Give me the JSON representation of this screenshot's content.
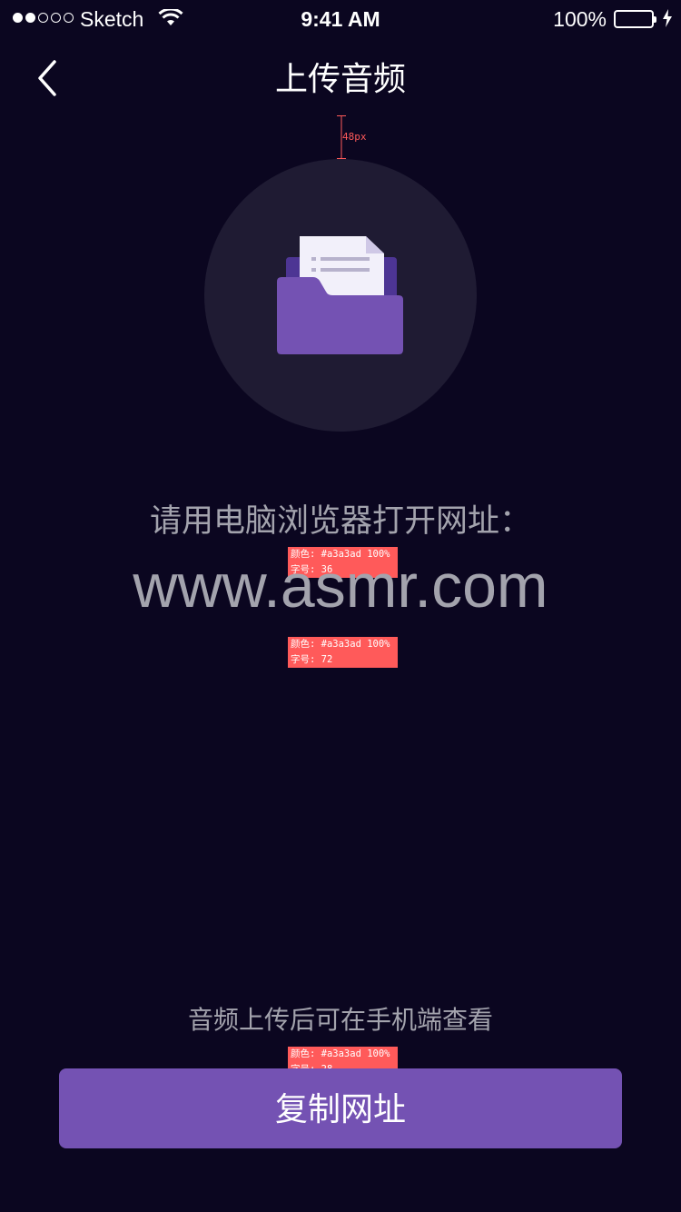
{
  "status_bar": {
    "carrier": "Sketch",
    "time": "9:41 AM",
    "battery_percent": "100%",
    "signal_strength": 2,
    "signal_total": 5,
    "battery_level": 1.0,
    "icons": [
      "signal-icon",
      "wifi-icon",
      "battery-icon",
      "charging-icon"
    ]
  },
  "nav": {
    "title": "上传音频",
    "back_icon": "chevron-left-icon"
  },
  "spec": {
    "spacing_label": "48px",
    "notes": [
      {
        "color_line": "颜色: #a3a3ad 100%",
        "size_line": "字号: 36"
      },
      {
        "color_line": "颜色: #a3a3ad 100%",
        "size_line": "字号: 72"
      },
      {
        "color_line": "颜色: #a3a3ad 100%",
        "size_line": "字号: 28"
      }
    ]
  },
  "content": {
    "illustration_icon": "folder-document-icon",
    "instruction": "请用电脑浏览器打开网址：",
    "url": "www.asmr.com",
    "hint": "音频上传后可在手机端查看"
  },
  "actions": {
    "copy_label": "复制网址"
  },
  "colors": {
    "background": "#0b0620",
    "text_muted": "#a3a3ad",
    "accent": "#7452b3",
    "circle": "#1f1b33",
    "annotation": "#ff5a5a",
    "battery": "#4cd964"
  }
}
